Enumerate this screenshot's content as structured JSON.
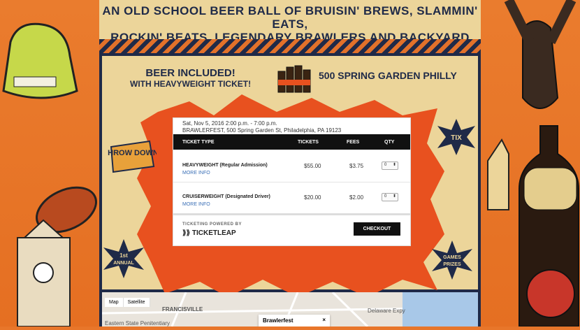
{
  "tagline": {
    "line1": "AN OLD SCHOOL BEER BALL OF BRUISIN' BREWS, SLAMMIN' EATS,",
    "line2": "ROCKIN' BEATS, LEGENDARY BRAWLERS AND BACKYARD GAMES."
  },
  "promo": {
    "beer_line1": "BEER INCLUDED!",
    "beer_line2": "WITH HEAVYWEIGHT TICKET!",
    "address": "500 SPRING GARDEN PHILLY"
  },
  "badges": {
    "throw_down": "THROW DOWN!",
    "tix": "TIX",
    "first_annual_1": "1st",
    "first_annual_2": "ANNUAL",
    "games_1": "GAMES",
    "games_2": "PRIZES"
  },
  "event": {
    "datetime": "Sat, Nov 5, 2016 2:00 p.m. - 7:00 p.m.",
    "venue": "BRAWLERFEST, 500 Spring Garden St, Philadelphia, PA 19123"
  },
  "table": {
    "headers": [
      "TICKET TYPE",
      "TICKETS",
      "FEES",
      "QTY"
    ],
    "rows": [
      {
        "name": "HEAVYWEIGHT (Regular Admission)",
        "more": "MORE INFO",
        "price": "$55.00",
        "fee": "$3.75",
        "qty": "0"
      },
      {
        "name": "CRUISERWEIGHT (Designated Driver)",
        "more": "MORE INFO",
        "price": "$20.00",
        "fee": "$2.00",
        "qty": "0"
      }
    ]
  },
  "footer": {
    "powered": "TICKETING POWERED BY",
    "brand": "TICKETLEAP",
    "checkout": "CHECKOUT"
  },
  "map": {
    "btn_map": "Map",
    "btn_satellite": "Satellite",
    "label_francisville": "FRANCISVILLE",
    "label_penitentiary": "Eastern State Penitentiary",
    "popup_title": "Brawlerfest",
    "label_delaware": "Delaware Expy"
  },
  "colors": {
    "navy": "#1f2a48",
    "orange": "#e8762a",
    "cream": "#ecd59a",
    "burst": "#e8511f"
  }
}
